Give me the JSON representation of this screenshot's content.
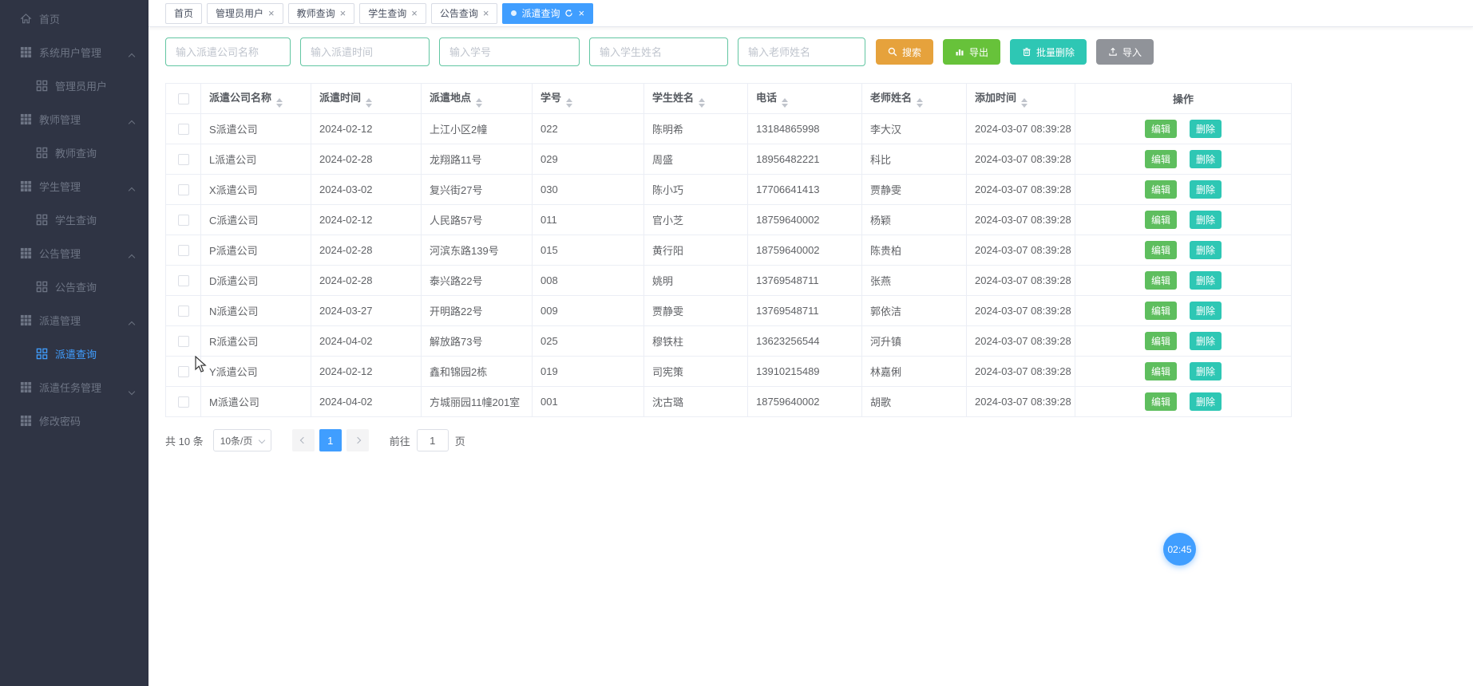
{
  "sidebar": {
    "items": [
      {
        "label": "首页"
      },
      {
        "label": "系统用户管理"
      },
      {
        "label": "管理员用户"
      },
      {
        "label": "教师管理"
      },
      {
        "label": "教师查询"
      },
      {
        "label": "学生管理"
      },
      {
        "label": "学生查询"
      },
      {
        "label": "公告管理"
      },
      {
        "label": "公告查询"
      },
      {
        "label": "派遣管理"
      },
      {
        "label": "派遣查询"
      },
      {
        "label": "派遣任务管理"
      },
      {
        "label": "修改密码"
      }
    ]
  },
  "tabs": [
    {
      "label": "首页"
    },
    {
      "label": "管理员用户"
    },
    {
      "label": "教师查询"
    },
    {
      "label": "学生查询"
    },
    {
      "label": "公告查询"
    },
    {
      "label": "派遣查询"
    }
  ],
  "icons": {
    "close": "×"
  },
  "filters": {
    "company_placeholder": "输入派遣公司名称",
    "time_placeholder": "输入派遣时间",
    "student_no_placeholder": "输入学号",
    "student_name_placeholder": "输入学生姓名",
    "teacher_name_placeholder": "输入老师姓名"
  },
  "toolbar": {
    "search": "搜索",
    "export": "导出",
    "batch_delete": "批量删除",
    "import": "导入"
  },
  "table": {
    "columns": [
      {
        "label": "派遣公司名称"
      },
      {
        "label": "派遣时间"
      },
      {
        "label": "派遣地点"
      },
      {
        "label": "学号"
      },
      {
        "label": "学生姓名"
      },
      {
        "label": "电话"
      },
      {
        "label": "老师姓名"
      },
      {
        "label": "添加时间"
      },
      {
        "label": "操作"
      }
    ],
    "row_actions": {
      "edit": "编辑",
      "delete": "删除"
    },
    "rows": [
      {
        "company": "S派遣公司",
        "dispatch_date": "2024-02-12",
        "address": "上江小区2幢",
        "student_no": "022",
        "student_name": "陈明希",
        "phone": "13184865998",
        "teacher_name": "李大汉",
        "added_time": "2024-03-07 08:39:28"
      },
      {
        "company": "L派遣公司",
        "dispatch_date": "2024-02-28",
        "address": "龙翔路11号",
        "student_no": "029",
        "student_name": "周盛",
        "phone": "18956482221",
        "teacher_name": "科比",
        "added_time": "2024-03-07 08:39:28"
      },
      {
        "company": "X派遣公司",
        "dispatch_date": "2024-03-02",
        "address": "复兴街27号",
        "student_no": "030",
        "student_name": "陈小巧",
        "phone": "17706641413",
        "teacher_name": "贾静雯",
        "added_time": "2024-03-07 08:39:28"
      },
      {
        "company": "C派遣公司",
        "dispatch_date": "2024-02-12",
        "address": "人民路57号",
        "student_no": "011",
        "student_name": "官小芝",
        "phone": "18759640002",
        "teacher_name": "杨颖",
        "added_time": "2024-03-07 08:39:28"
      },
      {
        "company": "P派遣公司",
        "dispatch_date": "2024-02-28",
        "address": "河滨东路139号",
        "student_no": "015",
        "student_name": "黄行阳",
        "phone": "18759640002",
        "teacher_name": "陈贵柏",
        "added_time": "2024-03-07 08:39:28"
      },
      {
        "company": "D派遣公司",
        "dispatch_date": "2024-02-28",
        "address": "泰兴路22号",
        "student_no": "008",
        "student_name": "姚明",
        "phone": "13769548711",
        "teacher_name": "张燕",
        "added_time": "2024-03-07 08:39:28"
      },
      {
        "company": "N派遣公司",
        "dispatch_date": "2024-03-27",
        "address": "开明路22号",
        "student_no": "009",
        "student_name": "贾静雯",
        "phone": "13769548711",
        "teacher_name": "郭依洁",
        "added_time": "2024-03-07 08:39:28"
      },
      {
        "company": "R派遣公司",
        "dispatch_date": "2024-04-02",
        "address": "解放路73号",
        "student_no": "025",
        "student_name": "穆铁柱",
        "phone": "13623256544",
        "teacher_name": "河升镇",
        "added_time": "2024-03-07 08:39:28"
      },
      {
        "company": "Y派遣公司",
        "dispatch_date": "2024-02-12",
        "address": "鑫和锦园2栋",
        "student_no": "019",
        "student_name": "司宪策",
        "phone": "13910215489",
        "teacher_name": "林嘉俐",
        "added_time": "2024-03-07 08:39:28"
      },
      {
        "company": "M派遣公司",
        "dispatch_date": "2024-04-02",
        "address": "方城丽园11幢201室",
        "student_no": "001",
        "student_name": "沈古璐",
        "phone": "18759640002",
        "teacher_name": "胡歌",
        "added_time": "2024-03-07 08:39:28"
      }
    ]
  },
  "pagination": {
    "total_text": "共 10 条",
    "page_size": "10条/页",
    "current_page": "1",
    "goto_prefix": "前往",
    "goto_value": "1",
    "goto_suffix": "页"
  },
  "floating_timer": "02:45",
  "colors": {
    "accent_blue": "#409EFF",
    "sidebar_bg": "#2f3444",
    "search_orange": "#e6a23c",
    "export_green": "#67c23a",
    "teal": "#2ec7b4",
    "import_gray": "#909399",
    "input_border_mint": "#62c6a2",
    "table_border": "#ebeef5"
  }
}
